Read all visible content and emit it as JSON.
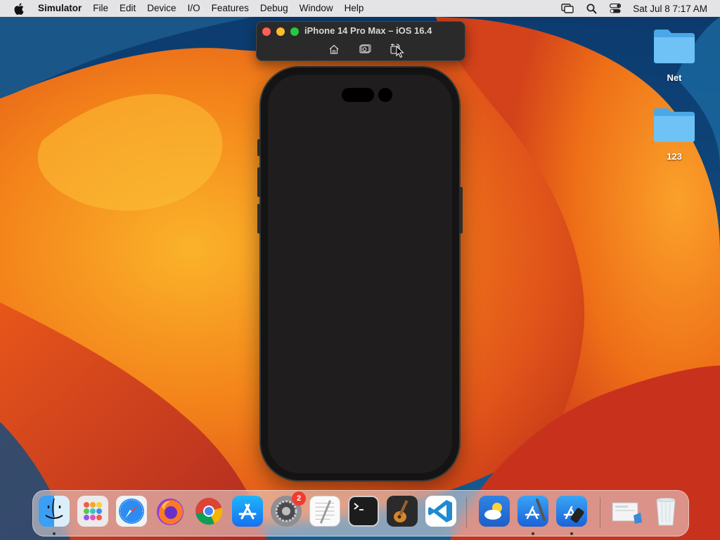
{
  "menubar": {
    "app_name": "Simulator",
    "menus": [
      "File",
      "Edit",
      "Device",
      "I/O",
      "Features",
      "Debug",
      "Window",
      "Help"
    ],
    "clock": "Sat Jul 8  7:17 AM"
  },
  "simulator": {
    "title": "iPhone 14 Pro Max – iOS 16.4",
    "buttons": [
      "home-icon",
      "screenshot-icon",
      "rotate-icon"
    ]
  },
  "desktop": {
    "icons": [
      {
        "label": "Net",
        "icon": "folder-icon"
      },
      {
        "label": "123",
        "icon": "folder-icon"
      }
    ]
  },
  "dock": {
    "apps": [
      {
        "name": "finder-icon",
        "running": true
      },
      {
        "name": "launchpad-icon",
        "running": false
      },
      {
        "name": "safari-icon",
        "running": false
      },
      {
        "name": "firefox-icon",
        "running": false
      },
      {
        "name": "chrome-icon",
        "running": false
      },
      {
        "name": "app-store-icon",
        "running": false
      },
      {
        "name": "system-settings-icon",
        "running": false,
        "badge": "2"
      },
      {
        "name": "textedit-icon",
        "running": false
      },
      {
        "name": "terminal-icon",
        "running": false
      },
      {
        "name": "garageband-icon",
        "running": false
      },
      {
        "name": "vscode-icon",
        "running": false
      },
      {
        "name": "weather-icon",
        "running": false
      },
      {
        "name": "xcode-icon",
        "running": true
      },
      {
        "name": "simulator-icon",
        "running": true
      },
      {
        "name": "recent-documents-icon",
        "running": false
      },
      {
        "name": "trash-icon",
        "running": false
      }
    ]
  },
  "colors": {
    "wallpaper_dark_blue": "#0f3f73",
    "wallpaper_orange": "#f28a16",
    "wallpaper_red": "#d63417",
    "phone_screen": "#1f1d1e"
  }
}
